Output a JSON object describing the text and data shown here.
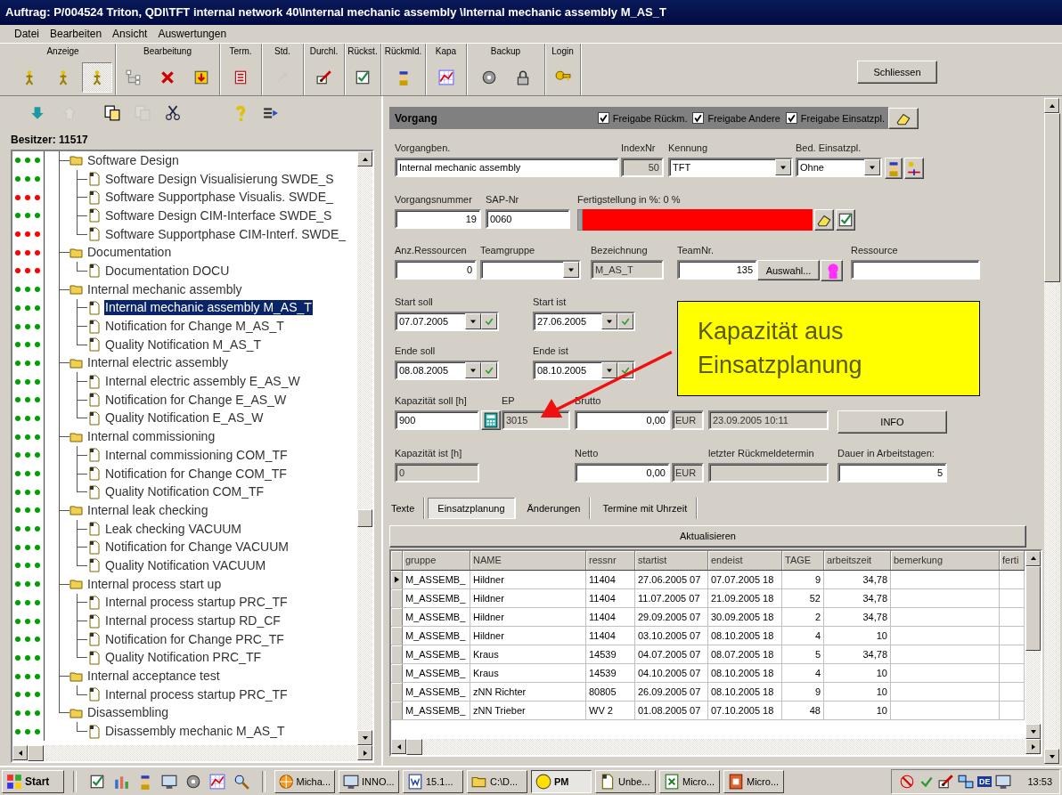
{
  "window": {
    "title": "Auftrag: P/004524 Triton, QDI\\TFT internal network 40\\Internal mechanic assembly \\Internal mechanic assembly M_AS_T"
  },
  "menu": [
    "Datei",
    "Bearbeiten",
    "Ansicht",
    "Auswertungen"
  ],
  "toolbar": {
    "groups": [
      {
        "label": "Anzeige",
        "tools": [
          {
            "selected": false,
            "disabled": false
          },
          {
            "selected": false,
            "disabled": false
          },
          {
            "selected": true,
            "disabled": false
          }
        ]
      },
      {
        "label": "Bearbeitung",
        "tools": [
          {
            "selected": false,
            "disabled": false
          },
          {
            "selected": false,
            "disabled": false
          },
          {
            "selected": false,
            "disabled": false
          }
        ]
      },
      {
        "label": "Term.",
        "tools": [
          {
            "selected": false,
            "disabled": false
          }
        ]
      },
      {
        "label": "Std.",
        "tools": [
          {
            "selected": false,
            "disabled": true
          }
        ]
      },
      {
        "label": "Durchl.",
        "tools": [
          {
            "selected": false,
            "disabled": false
          }
        ]
      },
      {
        "label": "Rückst.",
        "tools": [
          {
            "selected": false,
            "disabled": false
          }
        ]
      },
      {
        "label": "Rückmld.",
        "tools": [
          {
            "selected": false,
            "disabled": false
          }
        ]
      },
      {
        "label": "Kapa",
        "tools": [
          {
            "selected": false,
            "disabled": false
          }
        ]
      },
      {
        "label": "Backup",
        "tools": [
          {
            "selected": false,
            "disabled": false
          },
          {
            "selected": false,
            "disabled": false
          }
        ]
      },
      {
        "label": "Login",
        "tools": [
          {
            "selected": false,
            "disabled": false
          }
        ]
      }
    ],
    "close_button": "Schliessen"
  },
  "tree": {
    "tools": [
      {
        "disabled": false
      },
      {
        "disabled": true
      },
      {
        "disabled": false
      },
      {
        "disabled": true
      },
      {
        "disabled": false
      },
      {
        "disabled": false
      },
      {
        "disabled": false
      }
    ],
    "owner": "Besitzer: 11517",
    "items": [
      {
        "label": "Software Design",
        "color": "#00a000",
        "selected": false,
        "children": [
          {
            "label": "Software Design Visualisierung SWDE_S",
            "color": "#00a000",
            "selected": false
          },
          {
            "label": "Software Supportphase Visualis. SWDE_",
            "color": "#ff0000",
            "selected": false
          },
          {
            "label": "Software Design CIM-Interface SWDE_S",
            "color": "#00a000",
            "selected": false
          },
          {
            "label": "Software Supportphase CIM-Interf. SWDE_",
            "color": "#ff0000",
            "selected": false
          }
        ]
      },
      {
        "label": "Documentation",
        "color": "#ff0000",
        "selected": false,
        "children": [
          {
            "label": "Documentation DOCU",
            "color": "#ff0000",
            "selected": false
          }
        ]
      },
      {
        "label": "Internal mechanic assembly",
        "color": "#00a000",
        "selected": false,
        "children": [
          {
            "label": "Internal mechanic assembly M_AS_T",
            "color": "#00a000",
            "selected": true
          },
          {
            "label": "Notification for Change M_AS_T",
            "color": "#00a000",
            "selected": false
          },
          {
            "label": "Quality Notification M_AS_T",
            "color": "#00a000",
            "selected": false
          }
        ]
      },
      {
        "label": "Internal electric assembly",
        "color": "#00a000",
        "selected": false,
        "children": [
          {
            "label": "Internal electric assembly E_AS_W",
            "color": "#00a000",
            "selected": false
          },
          {
            "label": "Notification for Change E_AS_W",
            "color": "#00a000",
            "selected": false
          },
          {
            "label": "Quality Notification E_AS_W",
            "color": "#00a000",
            "selected": false
          }
        ]
      },
      {
        "label": "Internal commissioning",
        "color": "#00a000",
        "selected": false,
        "children": [
          {
            "label": "Internal commissioning COM_TF",
            "color": "#00a000",
            "selected": false
          },
          {
            "label": "Notification for Change COM_TF",
            "color": "#00a000",
            "selected": false
          },
          {
            "label": "Quality Notification COM_TF",
            "color": "#00a000",
            "selected": false
          }
        ]
      },
      {
        "label": "Internal leak checking",
        "color": "#00a000",
        "selected": false,
        "children": [
          {
            "label": "Leak checking VACUUM",
            "color": "#00a000",
            "selected": false
          },
          {
            "label": "Notification for Change VACUUM",
            "color": "#00a000",
            "selected": false
          },
          {
            "label": "Quality Notification VACUUM",
            "color": "#00a000",
            "selected": false
          }
        ]
      },
      {
        "label": "Internal process start up",
        "color": "#00a000",
        "selected": false,
        "children": [
          {
            "label": "Internal process startup PRC_TF",
            "color": "#00a000",
            "selected": false
          },
          {
            "label": "Internal process startup RD_CF",
            "color": "#00a000",
            "selected": false
          },
          {
            "label": "Notification for Change PRC_TF",
            "color": "#00a000",
            "selected": false
          },
          {
            "label": "Quality Notification PRC_TF",
            "color": "#00a000",
            "selected": false
          }
        ]
      },
      {
        "label": "Internal acceptance test",
        "color": "#00a000",
        "selected": false,
        "children": [
          {
            "label": "Internal process startup PRC_TF",
            "color": "#00a000",
            "selected": false
          }
        ]
      },
      {
        "label": "Disassembling",
        "color": "#00a000",
        "selected": false,
        "children": [
          {
            "label": "Disassembly mechanic M_AS_T",
            "color": "#00a000",
            "selected": false
          }
        ]
      }
    ]
  },
  "process": {
    "title": "Vorgang",
    "options": [
      {
        "label": "Freigabe Rückm.",
        "checked": true
      },
      {
        "label": "Freigabe Andere",
        "checked": true
      },
      {
        "label": "Freigabe Einsatzpl.",
        "checked": true
      }
    ],
    "sections": [
      {
        "fields": [
          {
            "kind": "text",
            "label": "Vorgangben.",
            "value": "Internal mechanic assembly"
          },
          {
            "kind": "readonly",
            "label": "IndexNr",
            "value": "50"
          },
          {
            "kind": "combo",
            "label": "Kennung",
            "value": "TFT"
          },
          {
            "kind": "combo",
            "label": "Bed. Einsatzpl.",
            "value": "Ohne"
          },
          {
            "kind": "icon_button"
          },
          {
            "kind": "icon_button"
          }
        ]
      },
      {
        "fields": [
          {
            "kind": "text",
            "label": "Vorgangsnummer",
            "value": "19"
          },
          {
            "kind": "text",
            "label": "SAP-Nr",
            "value": "0060"
          },
          {
            "kind": "progress",
            "label": "Fertigstellung in %: 0 %",
            "color": "#ff0000"
          },
          {
            "kind": "icon_button"
          },
          {
            "kind": "icon_button"
          }
        ]
      },
      {
        "fields": [
          {
            "kind": "text",
            "label": "Anz.Ressourcen",
            "value": "0"
          },
          {
            "kind": "combo",
            "label": "Teamgruppe"
          },
          {
            "kind": "readonly",
            "label": "Bezeichnung",
            "value": "M_AS_T"
          },
          {
            "kind": "text",
            "label": "TeamNr.",
            "value": "135"
          },
          {
            "kind": "button",
            "value": "Auswahl..."
          },
          {
            "kind": "icon_button"
          },
          {
            "kind": "text",
            "label": "Ressource"
          }
        ]
      },
      {
        "fields": [
          {
            "kind": "date",
            "label": "Start soll",
            "value": "07.07.2005"
          },
          {
            "kind": "date",
            "label": "Start ist",
            "value": "27.06.2005"
          }
        ]
      },
      {
        "fields": [
          {
            "kind": "date",
            "label": "Ende soll",
            "value": "08.08.2005"
          },
          {
            "kind": "date",
            "label": "Ende ist",
            "value": "08.10.2005"
          }
        ]
      },
      {
        "fields": [
          {
            "kind": "text",
            "label": "Kapazität soll [h]",
            "value": "900"
          },
          {
            "kind": "icon_button"
          },
          {
            "kind": "readonly",
            "label": "EP",
            "value": "3015"
          },
          {
            "kind": "text",
            "label": "Brutto",
            "value": "0,00"
          },
          {
            "kind": "unit",
            "value": "EUR"
          },
          {
            "kind": "readonly",
            "value": "23.09.2005 10:11"
          },
          {
            "kind": "button",
            "value": "INFO"
          }
        ]
      },
      {
        "fields": [
          {
            "kind": "readonly",
            "label": "Kapazität ist [h]",
            "value": "0"
          },
          {
            "kind": "text",
            "label": "Netto",
            "value": "0,00"
          },
          {
            "kind": "unit",
            "value": "EUR"
          },
          {
            "kind": "readonly",
            "label": "letzter Rückmeldetermin"
          },
          {
            "kind": "text",
            "label": "Dauer in Arbeitstagen:",
            "value": "5"
          }
        ]
      }
    ]
  },
  "callout": {
    "text": "Kapazität aus Einsatzplanung"
  },
  "tabs": [
    {
      "label": "Texte",
      "selected": false
    },
    {
      "label": "Einsatzplanung",
      "selected": true
    },
    {
      "label": "Änderungen",
      "selected": false
    },
    {
      "label": "Termine mit Uhrzeit",
      "selected": false
    }
  ],
  "refresh_button": "Aktualisieren",
  "table": {
    "columns": [
      "gruppe",
      "NAME",
      "ressnr",
      "startist",
      "endeist",
      "TAGE",
      "arbeitszeit",
      "bemerkung",
      "ferti"
    ],
    "rows": [
      {
        "selected": true,
        "cells": [
          "M_ASSEMB_",
          "Hildner",
          "11404",
          "27.06.2005 07",
          "07.07.2005 18",
          "9",
          "34,78"
        ]
      },
      {
        "selected": false,
        "cells": [
          "M_ASSEMB_",
          "Hildner",
          "11404",
          "11.07.2005 07",
          "21.09.2005 18",
          "52",
          "34,78"
        ]
      },
      {
        "selected": false,
        "cells": [
          "M_ASSEMB_",
          "Hildner",
          "11404",
          "29.09.2005 07",
          "30.09.2005 18",
          "2",
          "34,78"
        ]
      },
      {
        "selected": false,
        "cells": [
          "M_ASSEMB_",
          "Hildner",
          "11404",
          "03.10.2005 07",
          "08.10.2005 18",
          "4",
          "10"
        ]
      },
      {
        "selected": false,
        "cells": [
          "M_ASSEMB_",
          "Kraus",
          "14539",
          "04.07.2005 07",
          "08.07.2005 18",
          "5",
          "34,78"
        ]
      },
      {
        "selected": false,
        "cells": [
          "M_ASSEMB_",
          "Kraus",
          "14539",
          "04.10.2005 07",
          "08.10.2005 18",
          "4",
          "10"
        ]
      },
      {
        "selected": false,
        "cells": [
          "M_ASSEMB_",
          "zNN Richter",
          "80805",
          "26.09.2005 07",
          "08.10.2005 18",
          "9",
          "10"
        ]
      },
      {
        "selected": false,
        "cells": [
          "M_ASSEMB_",
          "zNN Trieber",
          "WV 2",
          "01.08.2005 07",
          "07.10.2005 18",
          "48",
          "10"
        ]
      }
    ]
  },
  "taskbar": {
    "start": "Start",
    "tasks": [
      {
        "label": "Micha...",
        "selected": false
      },
      {
        "label": "INNO...",
        "selected": false
      },
      {
        "label": "15.1...",
        "selected": false
      },
      {
        "label": "C:\\D...",
        "selected": false
      },
      {
        "label": "PM",
        "selected": true
      },
      {
        "label": "Unbe...",
        "selected": false
      },
      {
        "label": "Micro...",
        "selected": false
      },
      {
        "label": "Micro...",
        "selected": false
      }
    ],
    "language": "DE",
    "clock": "13:53"
  }
}
